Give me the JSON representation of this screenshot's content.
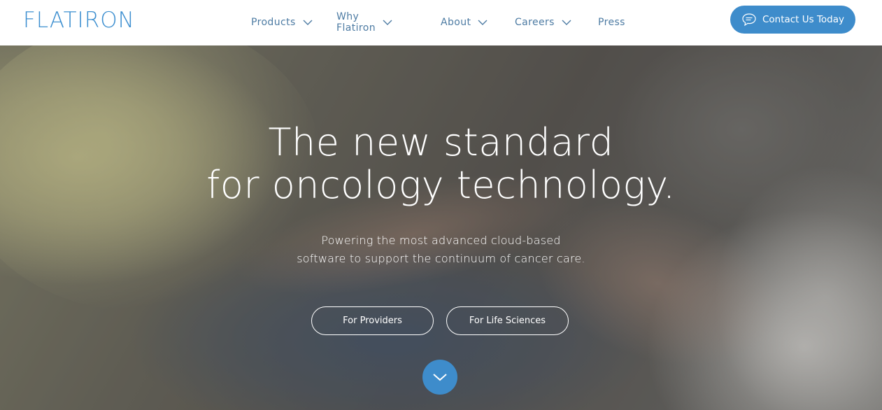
{
  "brand": {
    "logo_text": "FLATIRON",
    "accent_color": "#3e8ccb"
  },
  "nav": {
    "items": [
      {
        "label": "Products",
        "has_dropdown": true
      },
      {
        "label": "Why Flatiron",
        "has_dropdown": true
      },
      {
        "label": "About",
        "has_dropdown": true
      },
      {
        "label": "Careers",
        "has_dropdown": true
      },
      {
        "label": "Press",
        "has_dropdown": false
      }
    ],
    "contact_label": "Contact Us Today",
    "contact_icon": "chat-bubble-icon",
    "dropdown_icon": "chevron-down-icon"
  },
  "hero": {
    "headline_line1": "The new standard",
    "headline_line2": "for oncology technology.",
    "subline_line1": "Powering the most advanced cloud-based",
    "subline_line2": "software to support the continuum of cancer care.",
    "cta_providers": "For Providers",
    "cta_life_sciences": "For Life Sciences",
    "scroll_icon": "chevron-down-icon"
  }
}
